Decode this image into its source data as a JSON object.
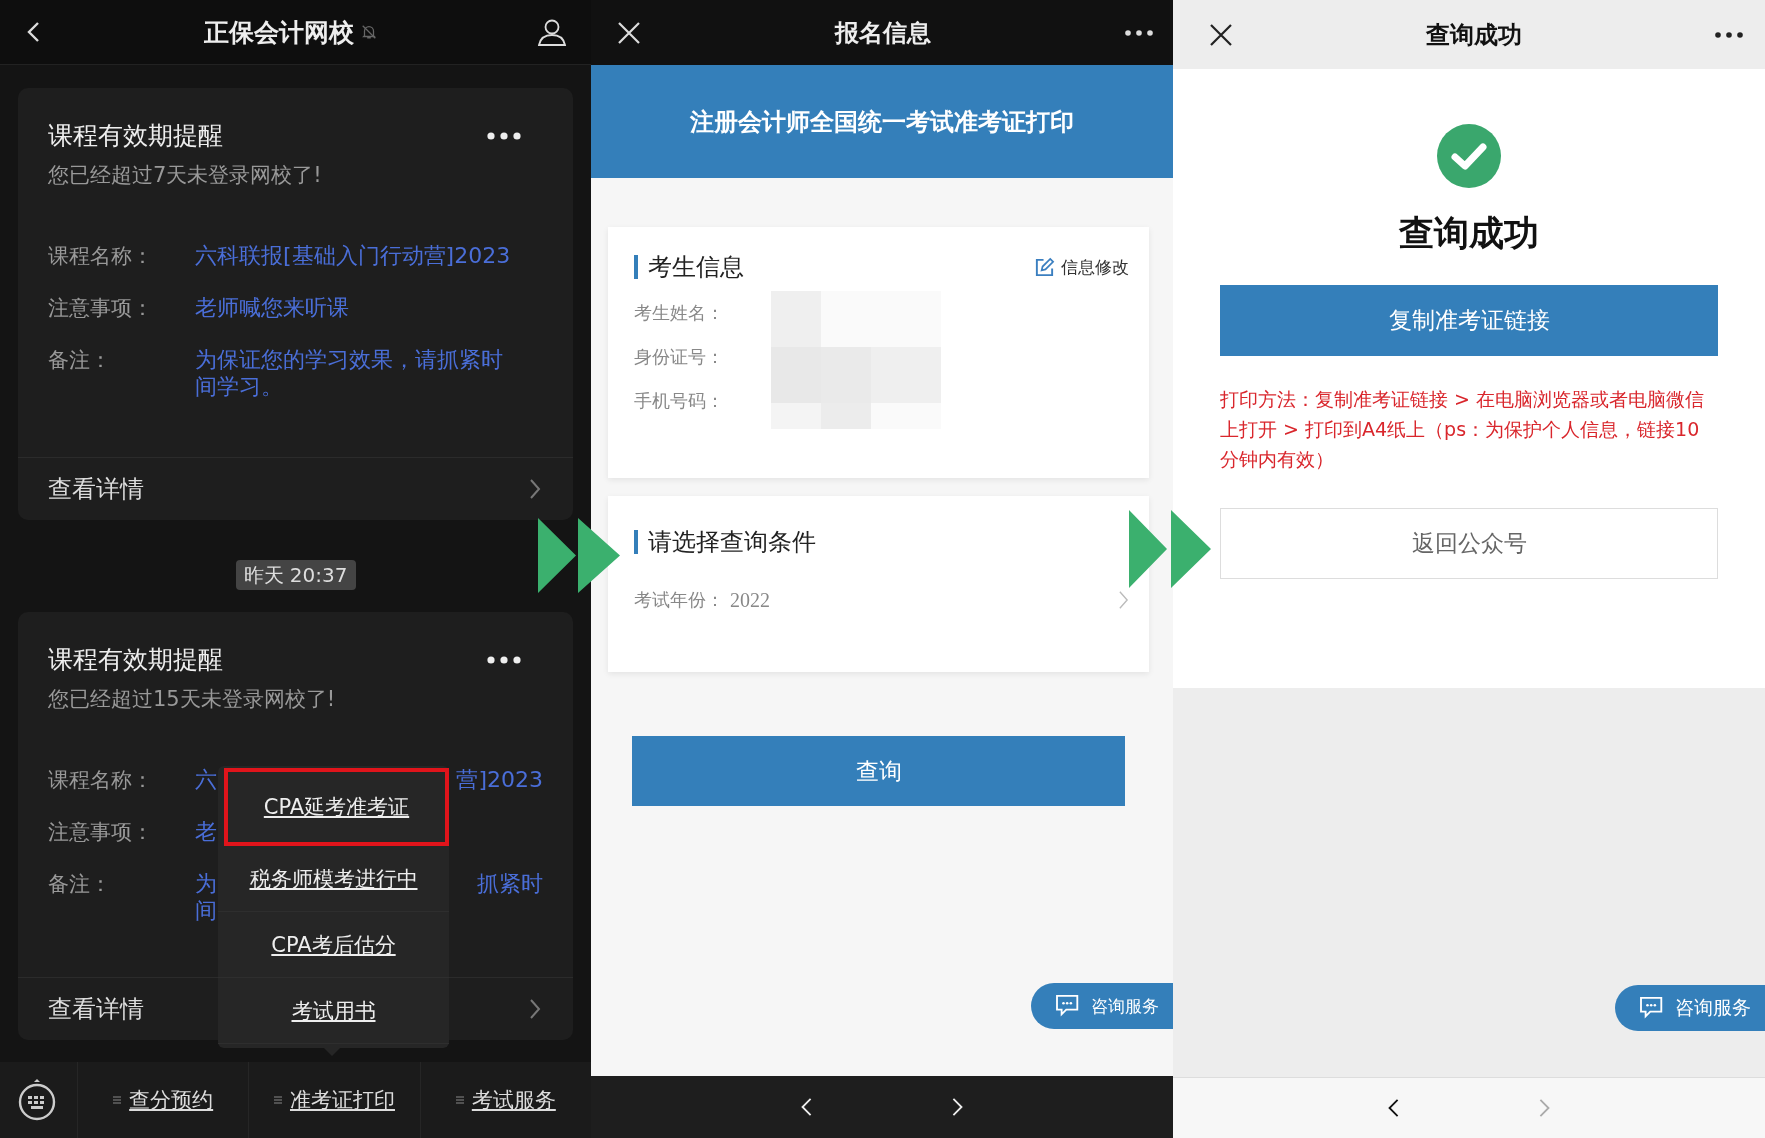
{
  "chat_screen": {
    "title": "正保会计网校",
    "muted": true,
    "cards": [
      {
        "title": "课程有效期提醒",
        "subtitle": "您已经超过7天未登录网校了!",
        "fields": [
          {
            "label": "课程名称：",
            "left": "六科联报[基础入门行动营]2023"
          },
          {
            "label": "注意事项：",
            "left": "老师喊您来听课"
          },
          {
            "label": "备注：",
            "left": "为保证您的学习效果，请抓紧时间学习。"
          }
        ],
        "footer": "查看详情"
      },
      {
        "title": "课程有效期提醒",
        "subtitle": "您已经超过15天未登录网校了!",
        "fields": [
          {
            "label": "课程名称：",
            "left": "六",
            "right": "营]2023"
          },
          {
            "label": "注意事项：",
            "left": "老"
          },
          {
            "label": "备注：",
            "left": "为",
            "left_line2": "间",
            "right": "抓紧时"
          }
        ],
        "footer": "查看详情"
      }
    ],
    "timestamp": "昨天 20:37",
    "popup_menu": [
      {
        "label": "CPA延考准考证",
        "highlighted": true
      },
      {
        "label": "税务师模考进行中",
        "highlighted": false
      },
      {
        "label": "CPA考后估分",
        "highlighted": false
      },
      {
        "label": "考试用书",
        "highlighted": false
      }
    ],
    "bottom_menu": [
      "查分预约",
      "准考证打印",
      "考试服务"
    ]
  },
  "registration_screen": {
    "title": "报名信息",
    "banner": "注册会计师全国统一考试准考证打印",
    "candidate_section": {
      "title": "考生信息",
      "edit_link": "信息修改",
      "fields": [
        "考生姓名：",
        "身份证号：",
        "手机号码："
      ]
    },
    "query_section": {
      "title": "请选择查询条件",
      "field_label": "考试年份：",
      "field_value": "2022"
    },
    "query_button": "查询",
    "consult_button": "咨询服务",
    "nav": [
      {
        "kind": "back",
        "disabled": false
      },
      {
        "kind": "forward",
        "disabled": false
      }
    ]
  },
  "result_screen": {
    "title": "查询成功",
    "heading": "查询成功",
    "copy_button": "复制准考证链接",
    "note": "打印方法：复制准考证链接 > 在电脑浏览器或者电脑微信上打开 > 打印到A4纸上（ps：为保护个人信息，链接10分钟内有效）",
    "return_button": "返回公众号",
    "consult_button": "咨询服务",
    "nav": [
      {
        "kind": "back",
        "disabled": false
      },
      {
        "kind": "forward",
        "disabled": true
      }
    ]
  }
}
